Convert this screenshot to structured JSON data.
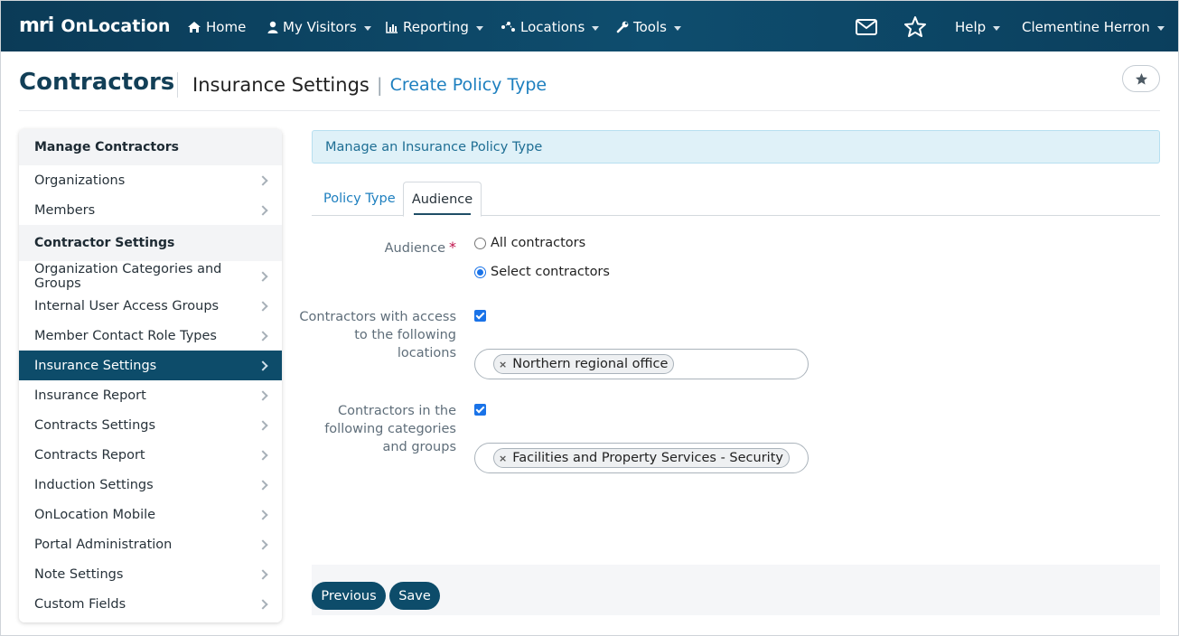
{
  "nav": {
    "logo_text": "mri",
    "brand": "OnLocation",
    "items": [
      {
        "label": "Home",
        "icon": "home-icon"
      },
      {
        "label": "My Visitors",
        "icon": "user-icon"
      },
      {
        "label": "Reporting",
        "icon": "chart-icon"
      },
      {
        "label": "Locations",
        "icon": "locations-icon"
      },
      {
        "label": "Tools",
        "icon": "wrench-icon"
      }
    ],
    "help": "Help",
    "user": "Clementine Herron"
  },
  "header": {
    "title": "Contractors",
    "section": "Insurance Settings",
    "separator": "|",
    "page": "Create Policy Type"
  },
  "sidebar": {
    "groups": [
      {
        "heading": "Manage Contractors",
        "items": [
          "Organizations",
          "Members"
        ]
      },
      {
        "heading": "Contractor Settings",
        "items": [
          "Organization Categories and Groups",
          "Internal User Access Groups",
          "Member Contact Role Types",
          "Insurance Settings",
          "Insurance Report",
          "Contracts Settings",
          "Contracts Report",
          "Induction Settings",
          "OnLocation Mobile",
          "Portal Administration",
          "Note Settings",
          "Custom Fields"
        ]
      }
    ],
    "active": "Insurance Settings"
  },
  "main": {
    "alert": "Manage an Insurance Policy Type",
    "tabs": [
      "Policy Type",
      "Audience"
    ],
    "active_tab": "Audience",
    "audience": {
      "label": "Audience",
      "required_mark": "*",
      "options": [
        "All contractors",
        "Select contractors"
      ],
      "selected": "Select contractors"
    },
    "locations": {
      "label_lines": [
        "Contractors with access",
        "to the following",
        "locations"
      ],
      "checked": true,
      "chip_remove": "×",
      "chips": [
        "Northern regional office"
      ]
    },
    "categories": {
      "label_lines": [
        "Contractors in the",
        "following categories",
        "and groups"
      ],
      "checked": true,
      "chip_remove": "×",
      "chips": [
        "Facilities and Property Services - Security"
      ]
    },
    "buttons": {
      "previous": "Previous",
      "save": "Save"
    }
  }
}
